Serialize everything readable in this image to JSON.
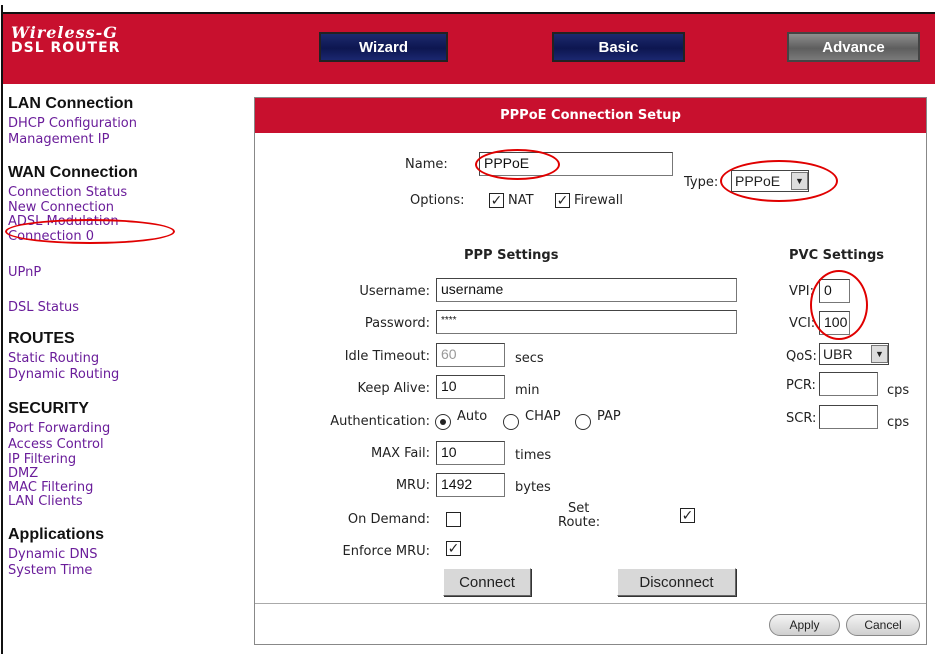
{
  "header": {
    "logo_line1": "Wireless-G",
    "logo_line2": "DSL ROUTER",
    "nav": {
      "wizard": "Wizard",
      "basic": "Basic",
      "advance": "Advance"
    }
  },
  "sidebar": {
    "lan_title": "LAN Connection",
    "lan_items": [
      "DHCP Configuration",
      "Management IP"
    ],
    "wan_title": "WAN Connection",
    "wan_items": [
      "Connection Status",
      "New Connection",
      "ADSL Modulation",
      "Connection 0"
    ],
    "upnp": "UPnP",
    "dsl_status": "DSL Status",
    "routes_title": "ROUTES",
    "routes_items": [
      "Static Routing",
      "Dynamic Routing"
    ],
    "security_title": "SECURITY",
    "security_items": [
      "Port Forwarding",
      "Access Control",
      "IP Filtering",
      "DMZ",
      "MAC Filtering",
      "LAN Clients"
    ],
    "apps_title": "Applications",
    "apps_items": [
      "Dynamic DNS",
      "System Time"
    ]
  },
  "panel": {
    "title": "PPPoE Connection Setup",
    "name_label": "Name:",
    "name_value": "PPPoE",
    "type_label": "Type:",
    "type_value": "PPPoE",
    "options_label": "Options:",
    "nat_label": "NAT",
    "nat_checked": true,
    "firewall_label": "Firewall",
    "firewall_checked": true,
    "ppp_title": "PPP Settings",
    "pvc_title": "PVC Settings",
    "username_label": "Username:",
    "username_value": "username",
    "password_label": "Password:",
    "password_value": "****",
    "idle_label": "Idle Timeout:",
    "idle_value": "60",
    "idle_unit": "secs",
    "keepalive_label": "Keep Alive:",
    "keepalive_value": "10",
    "keepalive_unit": "min",
    "auth_label": "Authentication:",
    "auth_auto": "Auto",
    "auth_chap": "CHAP",
    "auth_pap": "PAP",
    "auth_selected": "Auto",
    "maxfail_label": "MAX Fail:",
    "maxfail_value": "10",
    "maxfail_unit": "times",
    "mru_label": "MRU:",
    "mru_value": "1492",
    "mru_unit": "bytes",
    "ondemand_label": "On Demand:",
    "ondemand_checked": false,
    "setroute_label1": "Set",
    "setroute_label2": "Route:",
    "setroute_checked": true,
    "enforce_label": "Enforce MRU:",
    "enforce_checked": true,
    "connect_button": "Connect",
    "disconnect_button": "Disconnect",
    "vpi_label": "VPI:",
    "vpi_value": "0",
    "vci_label": "VCI:",
    "vci_value": "100",
    "qos_label": "QoS:",
    "qos_value": "UBR",
    "pcr_label": "PCR:",
    "pcr_unit": "cps",
    "scr_label": "SCR:",
    "scr_unit": "cps",
    "apply_button": "Apply",
    "cancel_button": "Cancel"
  },
  "colors": {
    "brand_red": "#c8102e",
    "nav_blue": "#0d1650",
    "link_purple": "#6a1d9a",
    "highlight": "#e00000"
  }
}
